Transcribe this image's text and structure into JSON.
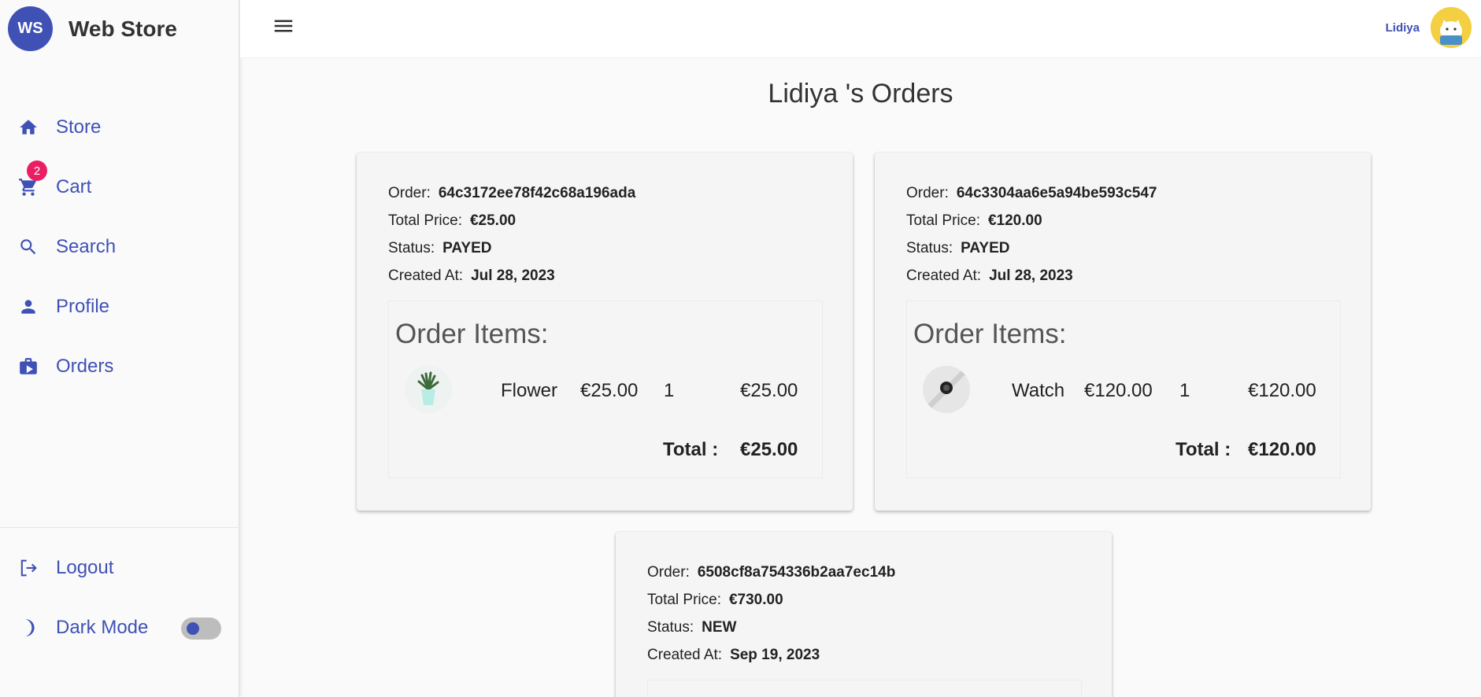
{
  "brand": {
    "logo_text": "WS",
    "title": "Web Store",
    "accent": "#3f51b5"
  },
  "nav": {
    "store": {
      "label": "Store",
      "icon": "home-icon"
    },
    "cart": {
      "label": "Cart",
      "icon": "cart-icon",
      "badge": "2"
    },
    "search": {
      "label": "Search",
      "icon": "search-icon"
    },
    "profile": {
      "label": "Profile",
      "icon": "person-icon"
    },
    "orders": {
      "label": "Orders",
      "icon": "orders-icon"
    },
    "logout": {
      "label": "Logout",
      "icon": "logout-icon"
    },
    "dark_mode": {
      "label": "Dark Mode",
      "icon": "moon-icon",
      "enabled": false
    }
  },
  "topbar": {
    "user_name": "Lidiya"
  },
  "page": {
    "title": "Lidiya 's Orders"
  },
  "labels": {
    "order": "Order:",
    "total_price": "Total Price:",
    "status": "Status:",
    "created_at": "Created At:",
    "order_items": "Order Items:",
    "total": "Total :"
  },
  "orders": [
    {
      "id": "64c3172ee78f42c68a196ada",
      "total_price": "€25.00",
      "status": "PAYED",
      "created_at": "Jul 28, 2023",
      "items": [
        {
          "name": "Flower",
          "price": "€25.00",
          "qty": "1",
          "subtotal": "€25.00",
          "image": "potted-plant"
        }
      ],
      "total": "€25.00"
    },
    {
      "id": "64c3304aa6e5a94be593c547",
      "total_price": "€120.00",
      "status": "PAYED",
      "created_at": "Jul 28, 2023",
      "items": [
        {
          "name": "Watch",
          "price": "€120.00",
          "qty": "1",
          "subtotal": "€120.00",
          "image": "smart-watch"
        }
      ],
      "total": "€120.00"
    },
    {
      "id": "6508cf8a754336b2aa7ec14b",
      "total_price": "€730.00",
      "status": "NEW",
      "created_at": "Sep 19, 2023"
    }
  ]
}
